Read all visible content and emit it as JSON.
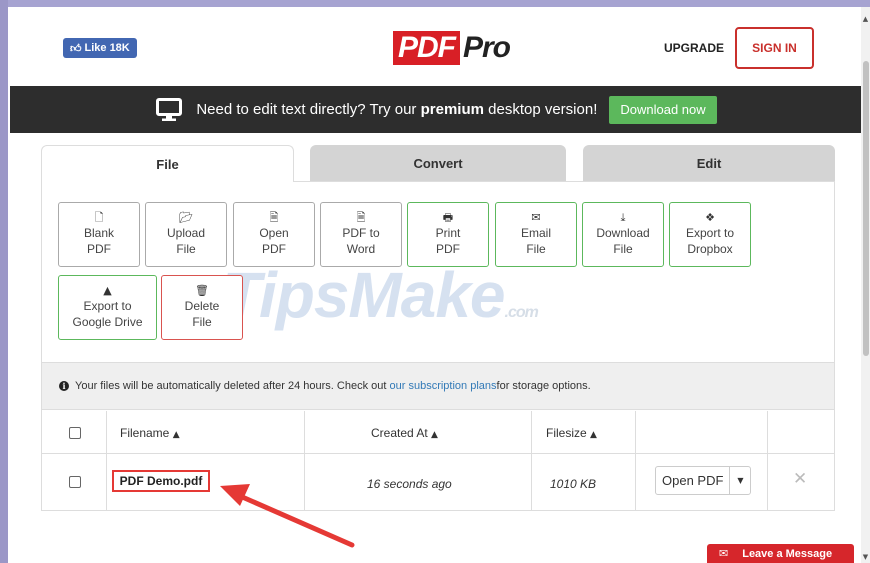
{
  "header": {
    "like_label": "Like 18K",
    "logo_pdf": "PDF",
    "logo_pro": "Pro",
    "upgrade_label": "UPGRADE",
    "signin_label": "SIGN IN"
  },
  "promo": {
    "text_before": "Need to edit text directly? Try our ",
    "text_bold": "premium",
    "text_after": " desktop version!",
    "download_label": "Download now"
  },
  "tabs": [
    {
      "label": "File"
    },
    {
      "label": "Convert"
    },
    {
      "label": "Edit"
    }
  ],
  "tools": [
    {
      "line1": "Blank",
      "line2": "PDF",
      "icon": "file-icon"
    },
    {
      "line1": "Upload",
      "line2": "File",
      "icon": "folder-open-icon"
    },
    {
      "line1": "Open",
      "line2": "PDF",
      "icon": "file-pdf-icon"
    },
    {
      "line1": "PDF to",
      "line2": "Word",
      "icon": "file-word-icon"
    },
    {
      "line1": "Print",
      "line2": "PDF",
      "icon": "print-icon"
    },
    {
      "line1": "Email",
      "line2": "File",
      "icon": "envelope-icon"
    },
    {
      "line1": "Download",
      "line2": "File",
      "icon": "download-icon"
    },
    {
      "line1": "Export to",
      "line2": "Dropbox",
      "icon": "dropbox-icon"
    },
    {
      "line1": "Export to",
      "line2": "Google Drive",
      "icon": "google-drive-icon"
    },
    {
      "line1": "Delete",
      "line2": "File",
      "icon": "trash-icon"
    }
  ],
  "watermark": {
    "main": "TipsMake",
    "suffix": ".com"
  },
  "notice": {
    "before": "Your files will be automatically deleted after 24 hours. Check out ",
    "link": "our subscription plans",
    "after": " for storage options."
  },
  "table": {
    "headers": {
      "filename": "Filename",
      "created": "Created At",
      "filesize": "Filesize"
    },
    "rows": [
      {
        "filename": "PDF Demo.pdf",
        "created": "16 seconds ago",
        "filesize": "1010 KB",
        "action": "Open PDF"
      }
    ]
  },
  "chat": {
    "label": "Leave a Message"
  },
  "colors": {
    "brand_red": "#d81f26",
    "promo_bg": "#2d2d2d",
    "success_green": "#5cb85c",
    "facebook_blue": "#4267b2",
    "link_blue": "#337ab7",
    "annotation_red": "#e53935"
  }
}
